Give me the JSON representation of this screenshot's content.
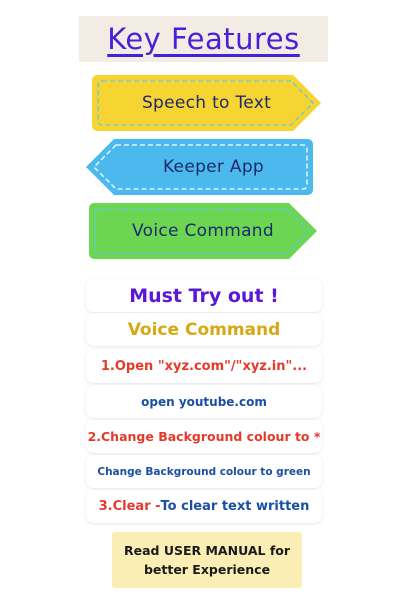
{
  "title": "Key Features",
  "features": [
    {
      "label": "Speech to Text",
      "color": "#f6d532"
    },
    {
      "label": "Keeper App",
      "color": "#4cb9ee"
    },
    {
      "label": "Voice Command",
      "color": "#6cd653"
    }
  ],
  "try_section": {
    "heading": "Must Try out !",
    "subheading": "Voice Command",
    "commands": [
      {
        "instruction": "1.Open \"xyz.com\"/\"xyz.in\"...",
        "example": "open youtube.com"
      },
      {
        "instruction": "2.Change Background colour to *",
        "example": "Change Background colour to green"
      },
      {
        "instruction_prefix": "3.Clear - ",
        "instruction_suffix": "To clear text written"
      }
    ]
  },
  "manual_note": {
    "line1": "Read USER MANUAL for",
    "line2": "better Experience"
  },
  "colors": {
    "title": "#4a1fd8",
    "heading": "#5a18d6",
    "subheading": "#d6a812",
    "instruction": "#e53a2a",
    "example": "#1a4fa3",
    "note_bg": "#fbeeb4"
  }
}
